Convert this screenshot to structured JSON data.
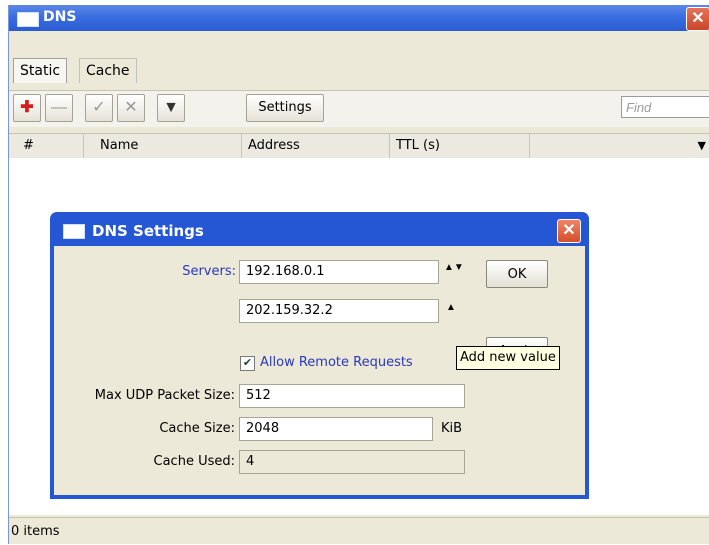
{
  "window": {
    "title": "DNS",
    "close_glyph": "✕"
  },
  "tabs": [
    {
      "label": "Static"
    },
    {
      "label": "Cache"
    }
  ],
  "toolbar": {
    "add_icon": "✚",
    "remove_icon": "—",
    "enable_icon": "✓",
    "disable_icon": "✕",
    "filter_icon": "▼",
    "settings_label": "Settings",
    "find_placeholder": "Find"
  },
  "columns": {
    "hash": "#",
    "name": "Name",
    "address": "Address",
    "ttl": "TTL (s)"
  },
  "status": {
    "items": "0 items"
  },
  "dialog": {
    "title": "DNS Settings",
    "close_glyph": "✕",
    "servers_label": "Servers:",
    "server1": "192.168.0.1",
    "server2": "202.159.32.2",
    "spinner_glyph": "▲▼",
    "allow_remote_label": "Allow Remote Requests",
    "allow_remote_checked": true,
    "check_glyph": "✔",
    "max_udp_label": "Max UDP Packet Size:",
    "max_udp_value": "512",
    "cache_size_label": "Cache Size:",
    "cache_size_value": "2048",
    "cache_size_unit": "KiB",
    "cache_used_label": "Cache Used:",
    "cache_used_value": "4",
    "ok_label": "OK",
    "apply_label": "Apply",
    "tooltip": "Add new value"
  },
  "colors": {
    "title_blue": "#2556d3",
    "label_blue": "#2a38b8",
    "add_red": "#d42020"
  }
}
